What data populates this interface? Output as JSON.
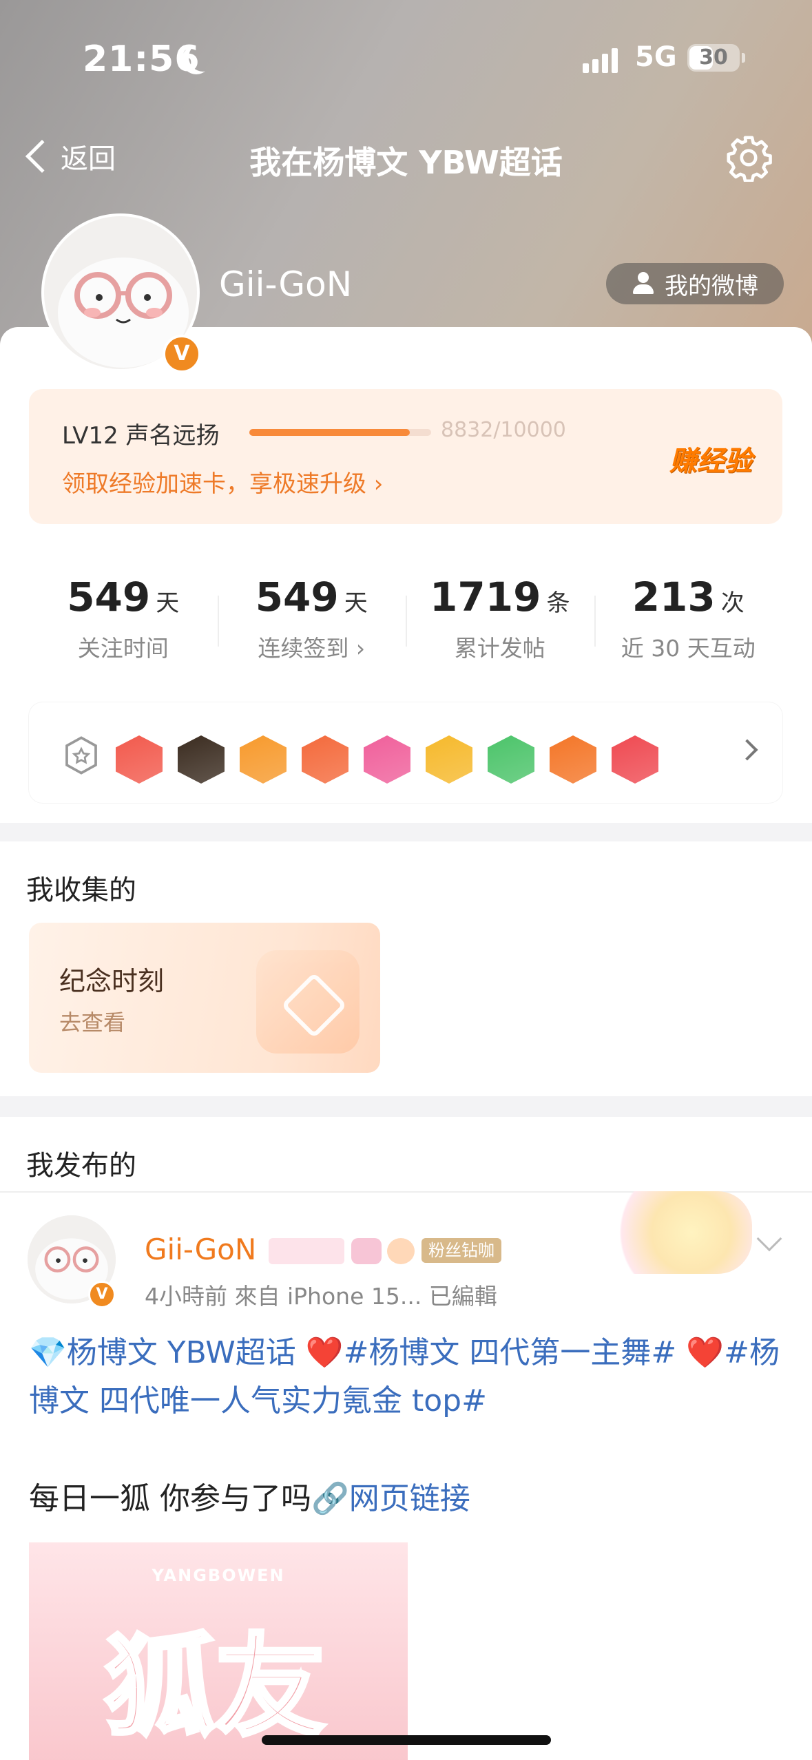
{
  "status_bar": {
    "time": "21:56",
    "network": "5G",
    "battery": "30"
  },
  "nav": {
    "back_label": "返回",
    "title": "我在杨博文 YBW超话"
  },
  "profile": {
    "username": "Gii-GoN",
    "my_weibo_label": "我的微博",
    "verified_mark": "V"
  },
  "level": {
    "label": "LV12 声名远扬",
    "progress_text": "8832/10000",
    "progress_fraction": 0.8832,
    "promo_link": "领取经验加速卡，享极速升级 ›",
    "earn_button": "赚经验"
  },
  "stats": [
    {
      "num": "549",
      "unit": "天",
      "label": "关注时间"
    },
    {
      "num": "549",
      "unit": "天",
      "label": "连续签到 ›"
    },
    {
      "num": "1719",
      "unit": "条",
      "label": "累计发帖"
    },
    {
      "num": "213",
      "unit": "次",
      "label": "近 30 天互动"
    }
  ],
  "badges": {
    "colors": [
      "#f25a4d",
      "#3b2c20",
      "#f79a2d",
      "#f46a3c",
      "#f0609b",
      "#f6b92c",
      "#4cc46a",
      "#f47628",
      "#ef4a52"
    ]
  },
  "collected": {
    "section_title": "我收集的",
    "card_title": "纪念时刻",
    "card_sub": "去查看"
  },
  "posted": {
    "section_title": "我发布的",
    "author": "Gii-GoN",
    "fan_badge": "粉丝钻咖",
    "meta": "4小時前  來自 iPhone 15...  已編輯",
    "content_line1": "💎杨博文 YBW超话 ",
    "heart": "❤️",
    "tag1": "#杨博文 四代第一主舞# ",
    "tag2": "#杨博文 四代唯一人气实力氪金 top#",
    "content_line2_text": "每日一狐 你参与了吗",
    "link_text": "🔗网页链接",
    "image_text_top": "YANGBOWEN",
    "image_text_big": "狐友"
  }
}
